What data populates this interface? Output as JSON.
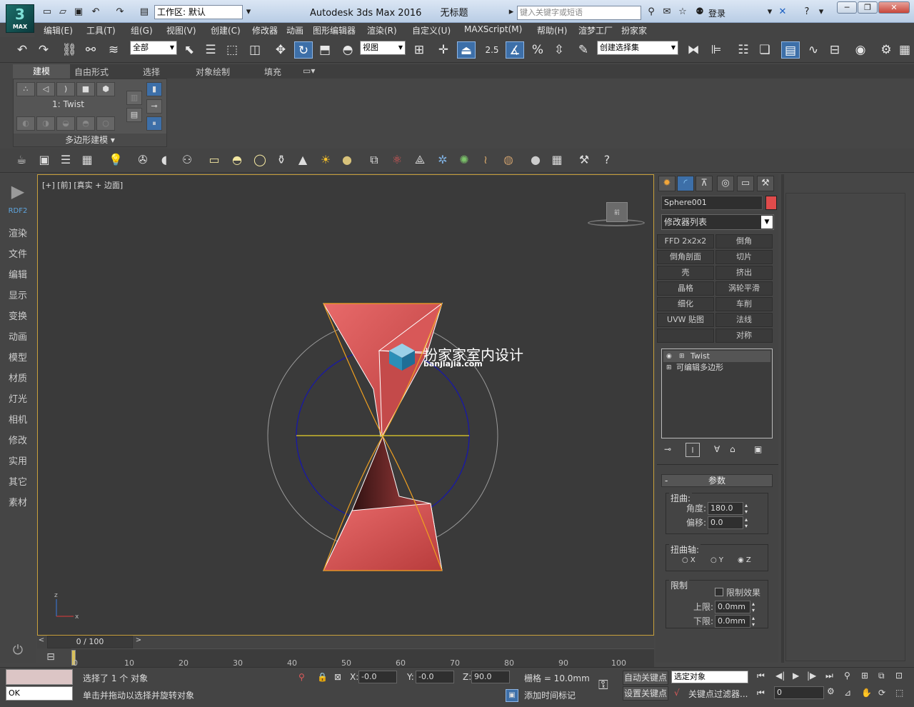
{
  "app": {
    "logo_label": "MAX",
    "workspace_label": "工作区: 默认",
    "title": "Autodesk 3ds Max 2016",
    "doc_title": "无标题",
    "search_placeholder": "键入关键字或短语",
    "login_label": "登录"
  },
  "menu": [
    "编辑(E)",
    "工具(T)",
    "组(G)",
    "视图(V)",
    "创建(C)",
    "修改器",
    "动画",
    "图形编辑器",
    "渲染(R)",
    "自定义(U)",
    "MAXScript(M)",
    "帮助(H)",
    "渲梦工厂",
    "扮家家"
  ],
  "toolbar": {
    "selection_filter": "全部",
    "ref_coord": "视图",
    "snap_value": "2.5",
    "named_selection": "创建选择集"
  },
  "ribbon": {
    "tabs": [
      "建模",
      "自由形式",
      "选择",
      "对象绘制",
      "填充"
    ],
    "modifier_label": "1: Twist",
    "panel_title": "多边形建模"
  },
  "left_panel": {
    "items": [
      "RDF2",
      "渲染",
      "文件",
      "编辑",
      "显示",
      "变换",
      "动画",
      "模型",
      "材质",
      "灯光",
      "相机",
      "修改",
      "实用",
      "其它",
      "素材"
    ]
  },
  "viewport": {
    "label": "[+] [前] [真实 + 边面]",
    "viewcube_label": "前",
    "axis_labels": {
      "z": "z",
      "x": "x"
    }
  },
  "watermark": {
    "title": "扮家家室内设计",
    "subtitle": "banjiajia.com"
  },
  "timeline": {
    "frame_display": "0 / 100",
    "ticks": [
      "0",
      "10",
      "20",
      "30",
      "40",
      "50",
      "60",
      "70",
      "80",
      "90",
      "100"
    ]
  },
  "command_panel": {
    "object_name": "Sphere001",
    "object_color": "#e04b4b",
    "modifier_list_label": "修改器列表",
    "modifier_buttons": [
      "FFD 2x2x2",
      "倒角",
      "倒角剖面",
      "切片",
      "壳",
      "挤出",
      "晶格",
      "涡轮平滑",
      "细化",
      "车削",
      "UVW 贴图",
      "法线",
      "",
      "对称"
    ],
    "stack": [
      "Twist",
      "可编辑多边形"
    ],
    "params_title": "参数",
    "twist_group": "扭曲:",
    "angle_label": "角度:",
    "angle_value": "180.0",
    "bias_label": "偏移:",
    "bias_value": "0.0",
    "axis_group": "扭曲轴:",
    "axis_options": [
      "X",
      "Y",
      "Z"
    ],
    "axis_selected": "Z",
    "limits_group": "限制",
    "limit_effect_label": "限制效果",
    "upper_label": "上限:",
    "upper_value": "0.0mm",
    "lower_label": "下限:",
    "lower_value": "0.0mm"
  },
  "status": {
    "maxscript_value": "OK",
    "selection_info": "选择了 1 个 对象",
    "prompt": "单击并拖动以选择并旋转对象",
    "x_label": "X:",
    "x_value": "-0.0",
    "y_label": "Y:",
    "y_value": "-0.0",
    "z_label": "Z:",
    "z_value": "90.0",
    "grid_label": "栅格 = 10.0mm",
    "add_time_tag": "添加时间标记",
    "auto_key": "自动关键点",
    "set_key": "设置关键点",
    "selected_objects": "选定对象",
    "key_filters": "关键点过滤器...",
    "frame_value": "0"
  }
}
